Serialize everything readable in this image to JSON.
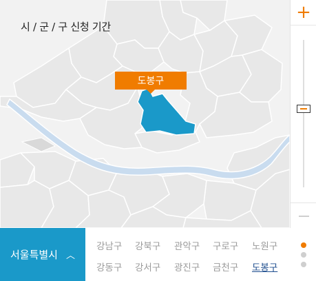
{
  "header": {
    "title": "시 / 군 / 구 신청 기간"
  },
  "map": {
    "selected_label": "도봉구",
    "highlight_color": "#1a99c9",
    "river_color": "#c9dcef"
  },
  "zoom": {
    "in_icon": "plus-icon",
    "out_icon": "minus-icon",
    "level": 0.5
  },
  "bottom": {
    "city_label": "서울특별시",
    "chevron_icon": "chevron-up-icon",
    "rows": [
      [
        "강남구",
        "강북구",
        "관악구",
        "구로구",
        "노원구"
      ],
      [
        "강동구",
        "강서구",
        "광진구",
        "금천구",
        "도봉구"
      ]
    ],
    "active": "도봉구",
    "page_count": 3,
    "page_active": 1
  },
  "colors": {
    "accent": "#f07c00",
    "brand": "#1a99c9"
  }
}
